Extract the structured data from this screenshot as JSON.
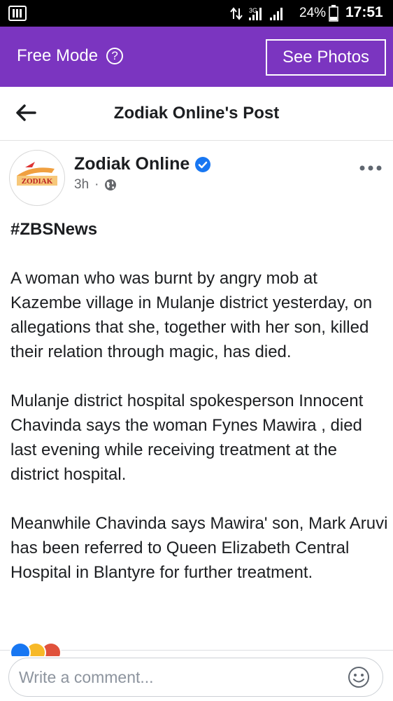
{
  "status_bar": {
    "network": "3G",
    "battery": "24%",
    "time": "17:51"
  },
  "top_bar": {
    "mode_label": "Free Mode",
    "help_symbol": "?",
    "see_photos_label": "See Photos",
    "background_color": "#7b35c0"
  },
  "header": {
    "title": "Zodiak Online's Post"
  },
  "post": {
    "author": "Zodiak Online",
    "time": "3h",
    "separator": "·",
    "hashtag": "#ZBSNews",
    "paragraphs": [
      "A woman who was burnt by angry mob at Kazembe village in Mulanje district yesterday, on allegations that she, together with her son, killed their relation through magic, has died.",
      "Mulanje district hospital spokesperson Innocent Chavinda says the woman Fynes Mawira , died last evening while receiving treatment at the district hospital.",
      "Meanwhile Chavinda says Mawira' son, Mark Aruvi has been referred to Queen Elizabeth Central Hospital in Blantyre for further treatment."
    ],
    "avatar_logo_text": "ZODIAK"
  },
  "comment": {
    "placeholder": "Write a comment..."
  },
  "icons": {
    "back": "back-arrow-icon",
    "verified": "verified-badge-icon",
    "audience": "globe-icon",
    "more": "more-options-icon",
    "emoji": "emoji-icon"
  },
  "colors": {
    "verified_blue": "#1877f2",
    "like_blue": "#1877f2",
    "haha_yellow": "#f7b928",
    "love_red": "#e0523c"
  }
}
